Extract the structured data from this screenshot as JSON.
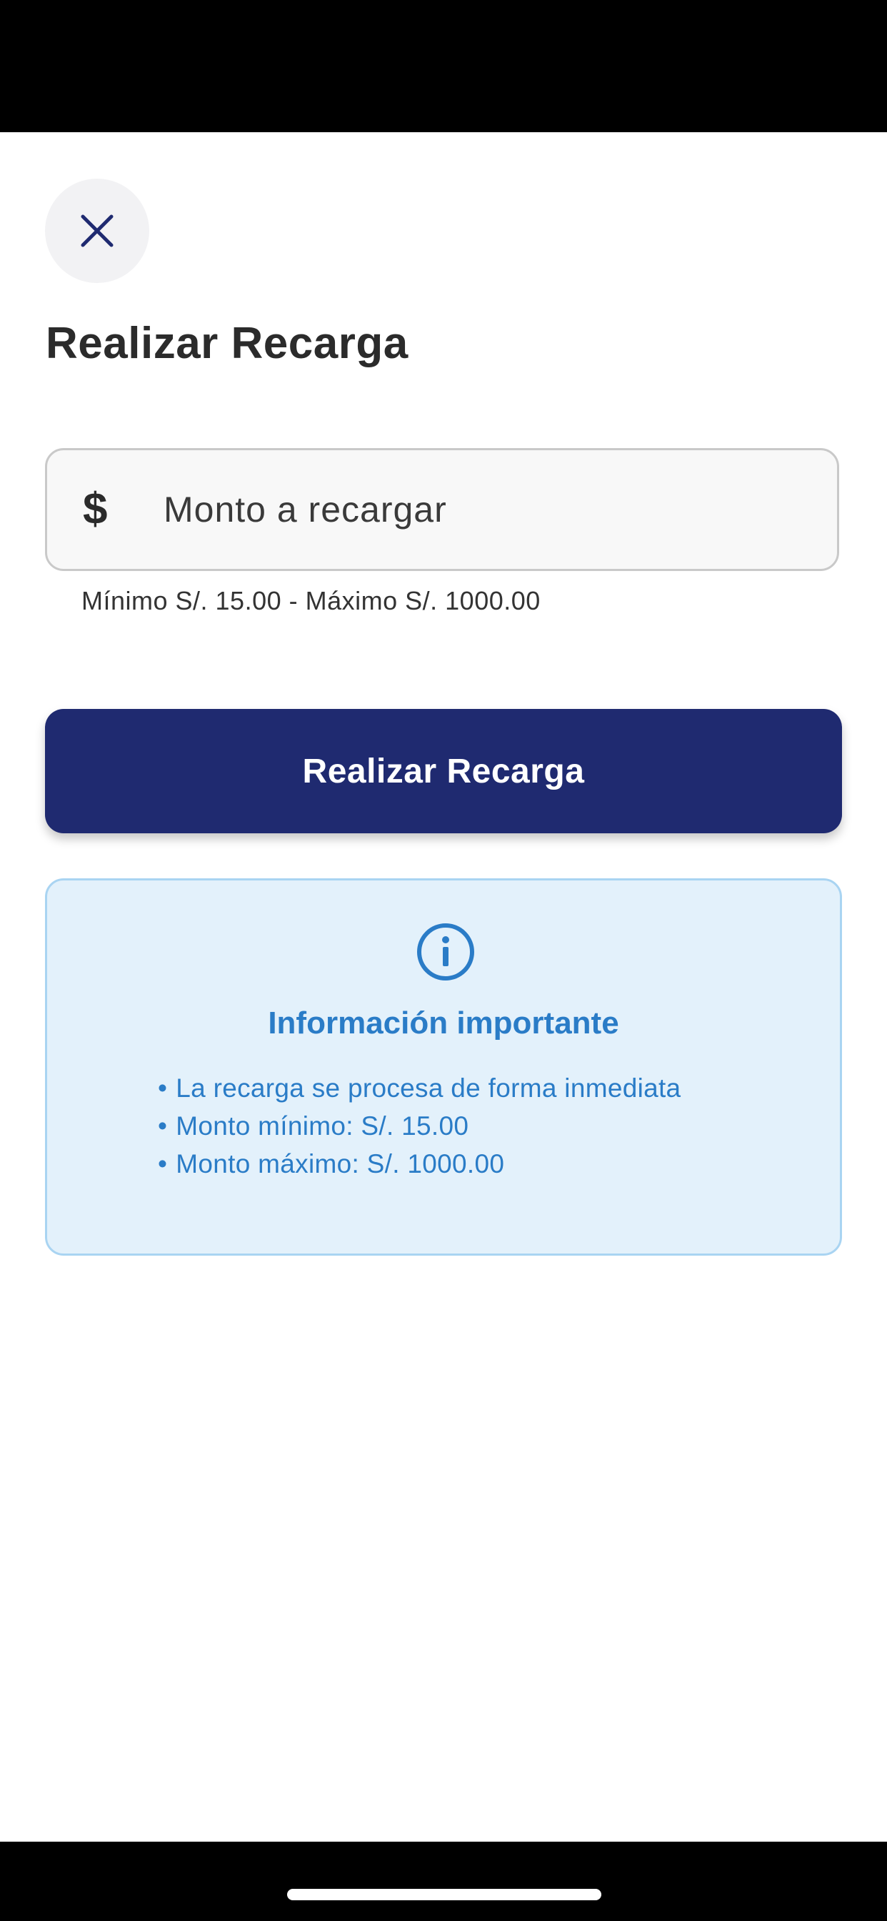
{
  "header": {
    "close_icon": "close-icon",
    "title": "Realizar Recarga"
  },
  "amount_field": {
    "currency_symbol": "$",
    "placeholder": "Monto a recargar",
    "value": "",
    "helper_text": "Mínimo S/. 15.00 - Máximo S/. 1000.00"
  },
  "submit": {
    "label": "Realizar Recarga"
  },
  "info_card": {
    "icon": "info-icon",
    "title": "Información importante",
    "items": [
      "La recarga se procesa de forma inmediata",
      "Monto mínimo: S/. 15.00",
      "Monto máximo: S/. 1000.00"
    ]
  },
  "colors": {
    "primary": "#1f2a70",
    "info_blue": "#2a7cc7",
    "info_background": "#e3f1fb",
    "info_border": "#a9d4f2"
  }
}
